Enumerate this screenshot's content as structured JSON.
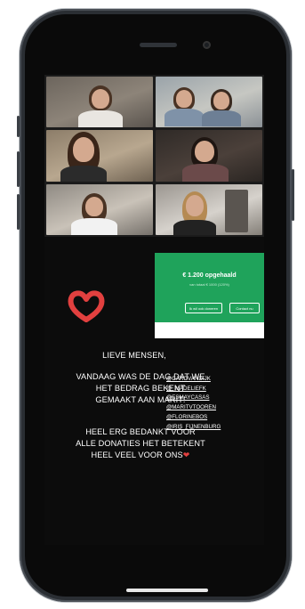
{
  "donation": {
    "amount": "€ 1.200 opgehaald",
    "sub": "van totaal € 1000 (120%)",
    "button1": "Ik wil ook doneren",
    "button2": "Contact nu"
  },
  "message": {
    "line1": "LIEVE MENSEN,",
    "para1": [
      "VANDAAG WAS DE DAG DAT WE",
      "HET BEDRAG BEKENT",
      "GEMAAKT AAN MARIT!"
    ],
    "para2": [
      "HEEL ERG BEDANKT VOOR",
      "ALLE DONATIES HET BETEKENT",
      "HEEL VEEL VOOR ONS"
    ],
    "heart_glyph": "❤"
  },
  "tags": [
    "@CAROVANDIJK",
    "@_MADELIEFK",
    "@ESMAYCASAS",
    "@MARITVTOOREN",
    "@FLORINEBOS",
    "@IRIS_FIJNENBURG"
  ],
  "colors": {
    "donation_green": "#1fa35b",
    "heart_red": "#e2403f"
  }
}
